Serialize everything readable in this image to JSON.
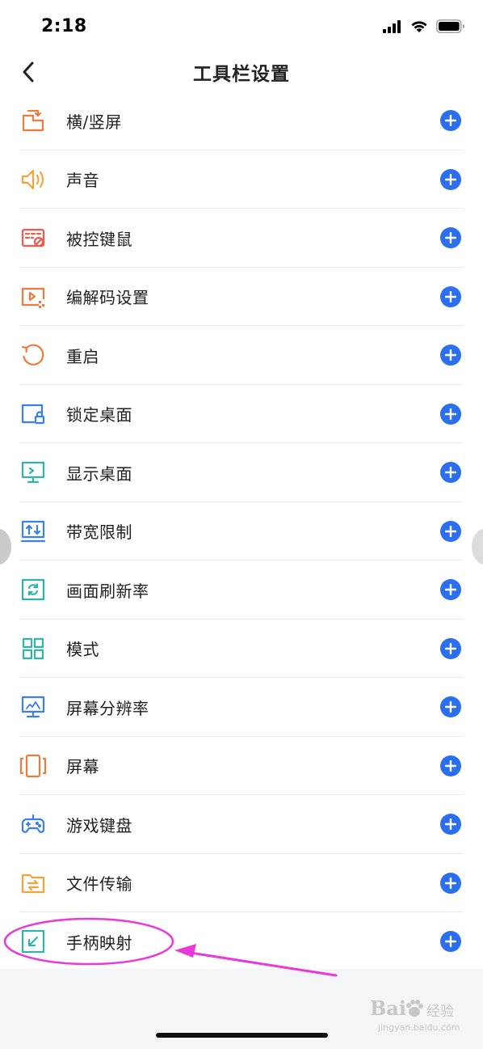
{
  "status_bar": {
    "time": "2:18"
  },
  "header": {
    "title": "工具栏设置",
    "back_icon": "chevron-left-icon"
  },
  "tools": [
    {
      "label": "横/竖屏",
      "icon": "rotate-screen-icon",
      "color": "#f07a3e"
    },
    {
      "label": "声音",
      "icon": "speaker-icon",
      "color": "#f5a33a"
    },
    {
      "label": "被控键鼠",
      "icon": "keyboard-disabled-icon",
      "color": "#ef5c4c"
    },
    {
      "label": "编解码设置",
      "icon": "codec-icon",
      "color": "#f07a3e"
    },
    {
      "label": "重启",
      "icon": "restart-icon",
      "color": "#f07a3e"
    },
    {
      "label": "锁定桌面",
      "icon": "lock-desktop-icon",
      "color": "#3b7ef0"
    },
    {
      "label": "显示桌面",
      "icon": "monitor-icon",
      "color": "#2fb4a8"
    },
    {
      "label": "带宽限制",
      "icon": "bandwidth-icon",
      "color": "#3b7ef0"
    },
    {
      "label": "画面刷新率",
      "icon": "refresh-rate-icon",
      "color": "#2fb4a8"
    },
    {
      "label": "模式",
      "icon": "grid-mode-icon",
      "color": "#2fb4a8"
    },
    {
      "label": "屏幕分辨率",
      "icon": "resolution-icon",
      "color": "#3b7ef0"
    },
    {
      "label": "屏幕",
      "icon": "screen-icon",
      "color": "#f07a3e"
    },
    {
      "label": "游戏键盘",
      "icon": "gamepad-icon",
      "color": "#3b7ef0"
    },
    {
      "label": "文件传输",
      "icon": "folder-transfer-icon",
      "color": "#f5a33a"
    },
    {
      "label": "手柄映射",
      "icon": "joystick-map-icon",
      "color": "#2fb4a8"
    }
  ],
  "colors": {
    "accent": "#2b6ff0",
    "annotation": "#e83ad9"
  },
  "watermark": {
    "brand": "Bai",
    "jingyan": "经验",
    "url": "jingyan.baidu.com"
  }
}
